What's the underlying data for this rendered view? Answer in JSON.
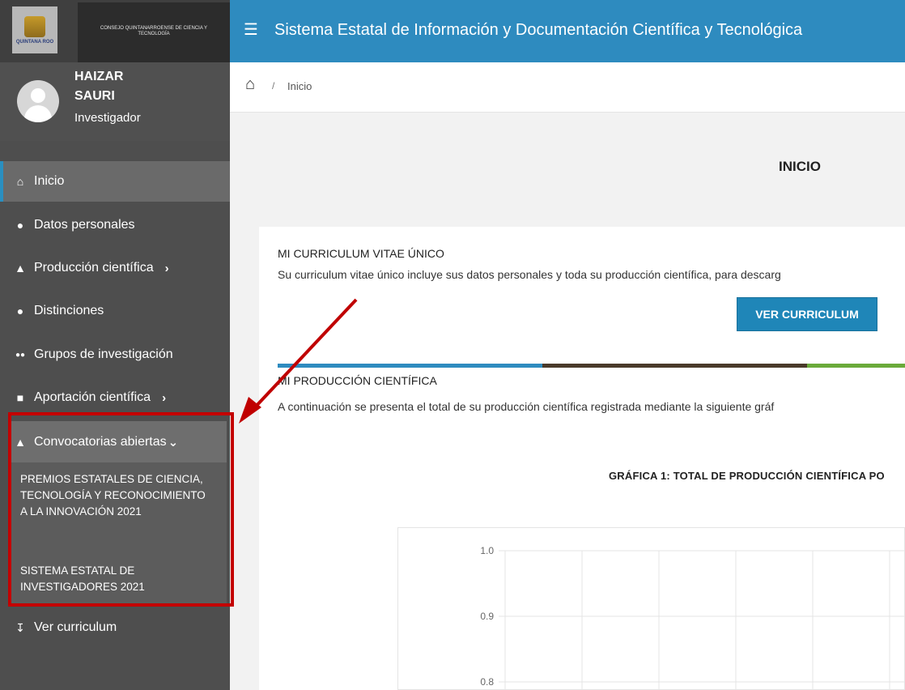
{
  "brand": {
    "logo_text": "QUINTANA ROO",
    "org_name": "CONSEJO QUINTANARROENSE DE CIENCIA Y TECNOLOGÍA"
  },
  "header": {
    "menu_icon": "menu-icon",
    "title": "Sistema Estatal de Información y Documentación Científica y Tecnológica"
  },
  "user": {
    "first_name": "HAIZAR",
    "last_name": "SAURI",
    "role": "Investigador"
  },
  "sidebar": {
    "items": [
      {
        "label": "Inicio",
        "icon": "home-icon"
      },
      {
        "label": "Datos personales",
        "icon": "user-icon"
      },
      {
        "label": "Producción científica",
        "icon": "flask-icon"
      },
      {
        "label": "Distinciones",
        "icon": "award-icon"
      },
      {
        "label": "Grupos de investigación",
        "icon": "group-icon"
      },
      {
        "label": "Aportación científica",
        "icon": "book-icon"
      },
      {
        "label": "Convocatorias abiertas",
        "icon": "flask-icon"
      },
      {
        "label": "Ver curriculum",
        "icon": "download-icon"
      }
    ],
    "submenu": [
      {
        "label": "PREMIOS ESTATALES DE CIENCIA, TECNOLOGÍA Y RECONOCIMIENTO A LA INNOVACIÓN 2021"
      },
      {
        "label": "SISTEMA ESTATAL DE INVESTIGADORES 2021"
      }
    ]
  },
  "breadcrumb": {
    "separator": "/",
    "current": "Inicio"
  },
  "main": {
    "page_title": "INICIO",
    "cv_heading": "MI CURRICULUM VITAE ÚNICO",
    "cv_text": "Su curriculum vitae único incluye sus datos personales y toda su producción científica, para descarg",
    "cv_button": "VER CURRICULUM",
    "prod_heading": "MI PRODUCCIÓN CIENTÍFICA",
    "prod_text": "A continuación se presenta el total de su producción científica registrada mediante la siguiente gráf",
    "chart_title": "GRÁFICA 1: TOTAL DE PRODUCCIÓN CIENTÍFICA PO"
  },
  "colors": {
    "accent": "#2e8bbf",
    "sidebar": "#4e4e4e",
    "highlight": "#c40000",
    "divider": [
      "#2e8bbf",
      "#4a3a2a",
      "#6aaa3a"
    ]
  },
  "chart_data": {
    "type": "line",
    "title": "GRÁFICA 1: TOTAL DE PRODUCCIÓN CIENTÍFICA PO",
    "y_ticks": [
      "1.0",
      "0.9",
      "0.8"
    ],
    "ylim": [
      0.8,
      1.0
    ],
    "grid": true,
    "series": []
  }
}
